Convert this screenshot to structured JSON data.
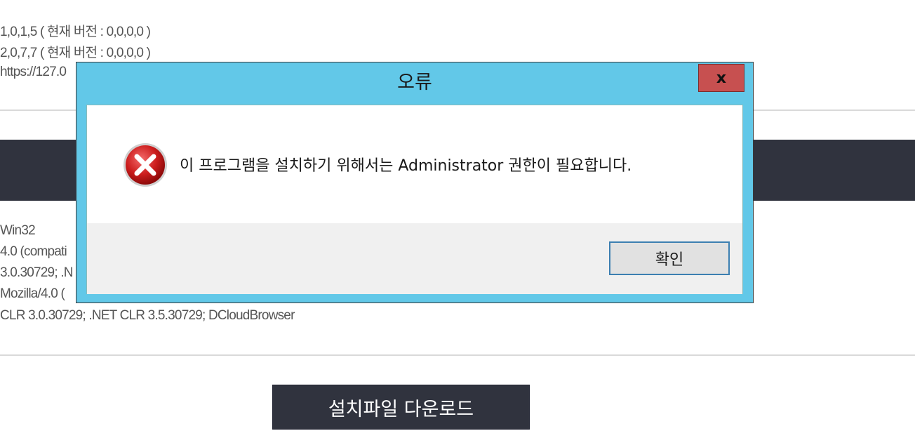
{
  "background": {
    "version_lines": [
      "1,0,1,5 ( 현재 버전 : 0,0,0,0 )",
      "2,0,7,7 ( 현재 버전 : 0,0,0,0 )",
      "https://127.0"
    ],
    "info_lines": [
      "Win32",
      "4.0 (compati",
      "3.0.30729; .N",
      "Mozilla/4.0 (",
      "CLR 3.0.30729; .NET CLR 3.5.30729; DCloudBrowser"
    ],
    "download_button": "설치파일 다운로드"
  },
  "dialog": {
    "title": "오류",
    "close_label": "x",
    "icon": "error-icon",
    "message": "이 프로그램을 설치하기 위해서는 Administrator 권한이 필요합니다.",
    "ok_label": "확인"
  },
  "colors": {
    "dialog_frame": "#62c8e8",
    "close_button": "#c75050",
    "dark_band": "#30333e"
  }
}
